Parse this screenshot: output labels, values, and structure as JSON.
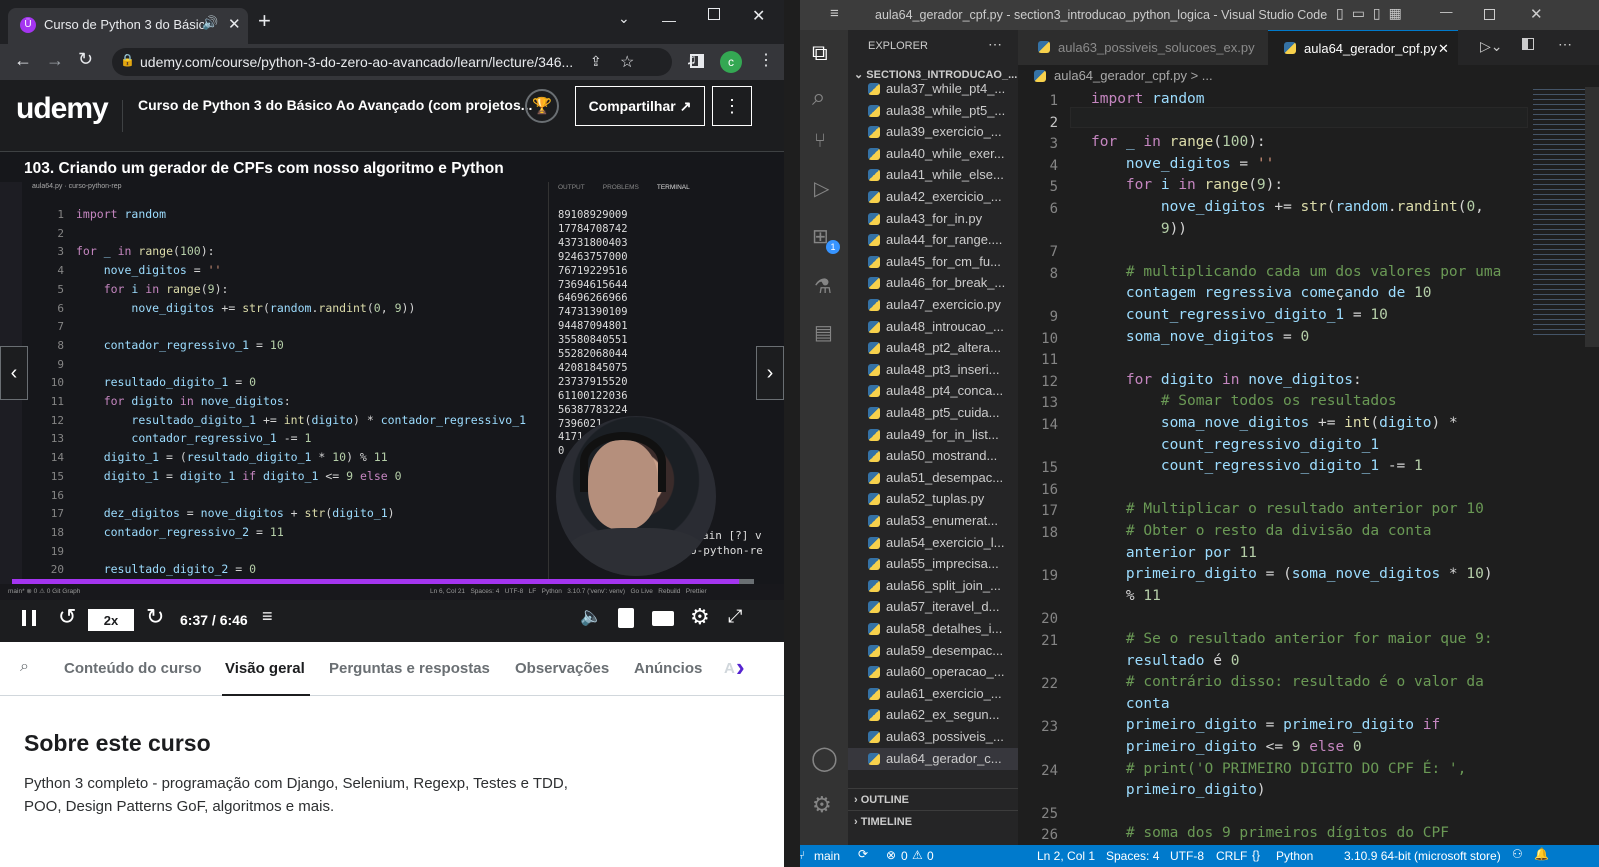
{
  "browser": {
    "tab_title": "Curso de Python 3 do Básico",
    "new_tab": "+",
    "url": "udemy.com/course/python-3-do-zero-ao-avancado/learn/lecture/346...",
    "profile_initial": "c"
  },
  "udemy": {
    "logo": "udemy",
    "course_title": "Curso de Python 3 do Básico Ao Avançado (com projetos...",
    "share_button": "Compartilhar",
    "lecture_title": "103. Criando um gerador de CPFs com nosso algoritmo e Python",
    "video": {
      "file_tab": "aula64.py",
      "breadcrumb": "curso-python-rep",
      "panel_tabs": [
        "OUTPUT",
        "PROBLEMS",
        "TERMINAL"
      ],
      "code_lines": [
        {
          "n": "1",
          "t": "import random"
        },
        {
          "n": "2",
          "t": ""
        },
        {
          "n": "3",
          "t": "for _ in range(100):"
        },
        {
          "n": "4",
          "t": "    nove_digitos = ''"
        },
        {
          "n": "5",
          "t": "    for i in range(9):"
        },
        {
          "n": "6",
          "t": "        nove_digitos += str(random.randint(0, 9))"
        },
        {
          "n": "7",
          "t": ""
        },
        {
          "n": "8",
          "t": "    contador_regressivo_1 = 10"
        },
        {
          "n": "9",
          "t": ""
        },
        {
          "n": "10",
          "t": "    resultado_digito_1 = 0"
        },
        {
          "n": "11",
          "t": "    for digito in nove_digitos:"
        },
        {
          "n": "12",
          "t": "        resultado_digito_1 += int(digito) * contador_regressivo_1"
        },
        {
          "n": "13",
          "t": "        contador_regressivo_1 -= 1"
        },
        {
          "n": "14",
          "t": "    digito_1 = (resultado_digito_1 * 10) % 11"
        },
        {
          "n": "15",
          "t": "    digito_1 = digito_1 if digito_1 <= 9 else 0"
        },
        {
          "n": "16",
          "t": ""
        },
        {
          "n": "17",
          "t": "    dez_digitos = nove_digitos + str(digito_1)"
        },
        {
          "n": "18",
          "t": "    contador_regressivo_2 = 11"
        },
        {
          "n": "19",
          "t": ""
        },
        {
          "n": "20",
          "t": "    resultado_digito_2 = 0"
        }
      ],
      "terminal_lines": [
        "89108929009",
        "17784708742",
        "43731800403",
        "92463757000",
        "76719229516",
        "73694615644",
        "64696266966",
        "74731390109",
        "94487094801",
        "35580840551",
        "55282068044",
        "42081845075",
        "23737915520",
        "61100122036",
        "56387783224",
        "7396021",
        "4171",
        "0",
        "",
        "",
        "",
        ""
      ],
      "terminal_tail": [
        "ain [?] v",
        "o-python-re"
      ],
      "status_left": "main*  ⊗ 0 ⚠ 0   Git Graph",
      "status_right": "Ln 6, Col 21   Spaces: 4   UTF-8   LF   Python   3.10.7 ('venv': venv)   Go Live   Rebuild   Prettier"
    },
    "controls": {
      "speed": "2x",
      "time": "6:37 / 6:46",
      "progress": 0.98
    },
    "course_tabs": [
      "Conteúdo do curso",
      "Visão geral",
      "Perguntas e respostas",
      "Observações",
      "Anúncios",
      "A"
    ],
    "active_tab_index": 1,
    "about_title": "Sobre este curso",
    "about_text": "Python 3 completo - programação com Django, Selenium, Regexp, Testes e TDD, POO, Design Patterns GoF, algoritmos e mais."
  },
  "vscode": {
    "title": "aula64_gerador_cpf.py - section3_introducao_python_logica - Visual Studio Code",
    "explorer_label": "EXPLORER",
    "folder": "SECTION3_INTRODUCAO_...",
    "files": [
      "aula37_while_pt4_...",
      "aula38_while_pt5_...",
      "aula39_exercicio_...",
      "aula40_while_exer...",
      "aula41_while_else...",
      "aula42_exercicio_...",
      "aula43_for_in.py",
      "aula44_for_range....",
      "aula45_for_cm_fu...",
      "aula46_for_break_...",
      "aula47_exercicio.py",
      "aula48_introucao_...",
      "aula48_pt2_altera...",
      "aula48_pt3_inseri...",
      "aula48_pt4_conca...",
      "aula48_pt5_cuida...",
      "aula49_for_in_list...",
      "aula50_mostrand...",
      "aula51_desempac...",
      "aula52_tuplas.py",
      "aula53_enumerat...",
      "aula54_exercicio_l...",
      "aula55_imprecisa...",
      "aula56_split_join_...",
      "aula57_iteravel_d...",
      "aula58_detalhes_i...",
      "aula59_desempac...",
      "aula60_operacao_...",
      "aula61_exercicio_...",
      "aula62_ex_segun...",
      "aula63_possiveis_...",
      "aula64_gerador_c..."
    ],
    "selected_file": 31,
    "outline": "OUTLINE",
    "timeline": "TIMELINE",
    "tabs": [
      "aula63_possiveis_solucoes_ex.py",
      "aula64_gerador_cpf.py"
    ],
    "breadcrumb": "aula64_gerador_cpf.py > ...",
    "badge": "1",
    "lines": [
      {
        "n": "1",
        "t": "import random"
      },
      {
        "n": "2",
        "t": ""
      },
      {
        "n": "3",
        "t": "for _ in range(100):"
      },
      {
        "n": "4",
        "t": "    nove_digitos = ''"
      },
      {
        "n": "5",
        "t": "    for i in range(9):"
      },
      {
        "n": "6",
        "t": "        nove_digitos += str(random.randint(0,"
      },
      {
        "n": "",
        "t": "        9))"
      },
      {
        "n": "7",
        "t": ""
      },
      {
        "n": "8",
        "t": "    # multiplicando cada um dos valores por uma"
      },
      {
        "n": "",
        "t": "    contagem regressiva começando de 10"
      },
      {
        "n": "9",
        "t": "    count_regressivo_digito_1 = 10"
      },
      {
        "n": "10",
        "t": "    soma_nove_digitos = 0"
      },
      {
        "n": "11",
        "t": ""
      },
      {
        "n": "12",
        "t": "    for digito in nove_digitos:"
      },
      {
        "n": "13",
        "t": "        # Somar todos os resultados"
      },
      {
        "n": "14",
        "t": "        soma_nove_digitos += int(digito) *"
      },
      {
        "n": "",
        "t": "        count_regressivo_digito_1"
      },
      {
        "n": "15",
        "t": "        count_regressivo_digito_1 -= 1"
      },
      {
        "n": "16",
        "t": ""
      },
      {
        "n": "17",
        "t": "    # Multiplicar o resultado anterior por 10"
      },
      {
        "n": "18",
        "t": "    # Obter o resto da divisão da conta"
      },
      {
        "n": "",
        "t": "    anterior por 11"
      },
      {
        "n": "19",
        "t": "    primeiro_digito = (soma_nove_digitos * 10)"
      },
      {
        "n": "",
        "t": "    % 11"
      },
      {
        "n": "20",
        "t": ""
      },
      {
        "n": "21",
        "t": "    # Se o resultado anterior for maior que 9:"
      },
      {
        "n": "",
        "t": "    resultado é 0"
      },
      {
        "n": "22",
        "t": "    # contrário disso: resultado é o valor da"
      },
      {
        "n": "",
        "t": "    conta"
      },
      {
        "n": "23",
        "t": "    primeiro_digito = primeiro_digito if"
      },
      {
        "n": "",
        "t": "    primeiro_digito <= 9 else 0"
      },
      {
        "n": "24",
        "t": "    # print('O PRIMEIRO DIGITO DO CPF É: ',"
      },
      {
        "n": "",
        "t": "    primeiro_digito)"
      },
      {
        "n": "25",
        "t": ""
      },
      {
        "n": "26",
        "t": "    # soma dos 9 primeiros dígitos do CPF"
      }
    ],
    "status": {
      "branch": "main",
      "errors": "0",
      "warnings": "0",
      "position": "Ln 2, Col 1",
      "spaces": "Spaces: 4",
      "encoding": "UTF-8",
      "eol": "CRLF",
      "language": "Python",
      "interpreter": "3.10.9 64-bit (microsoft store)"
    }
  }
}
